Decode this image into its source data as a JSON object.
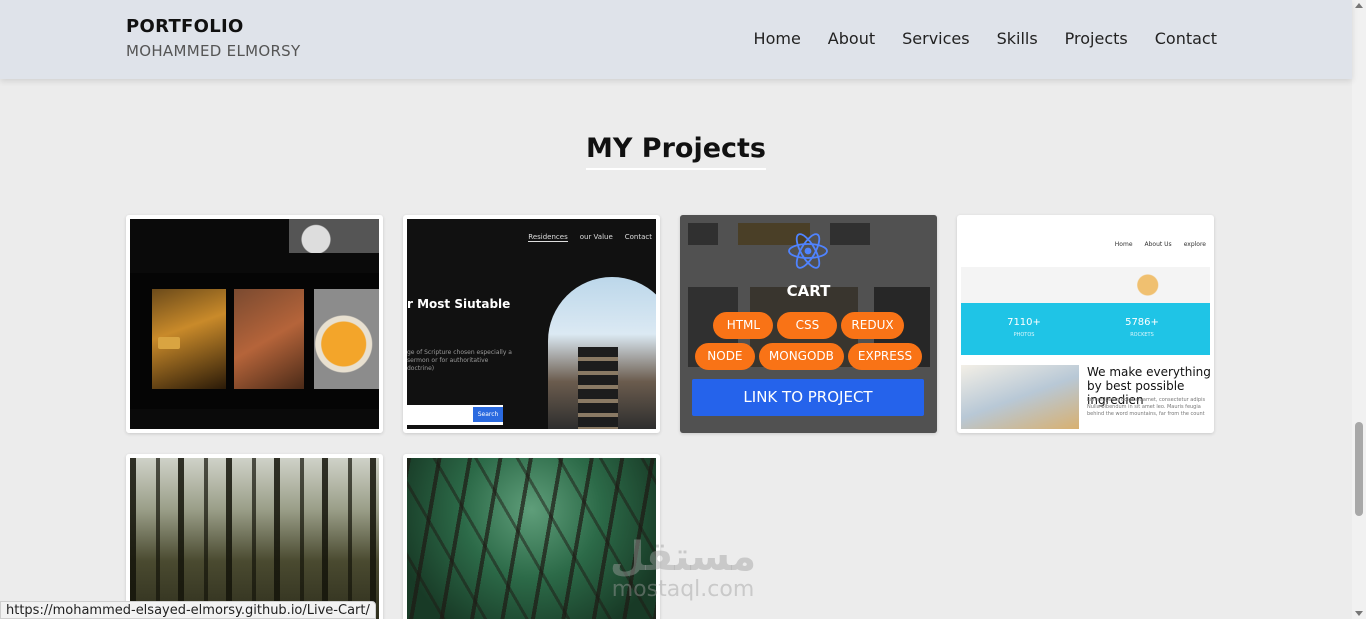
{
  "header": {
    "brand_title": "PORTFOLIO",
    "brand_subtitle": "MOHAMMED ELMORSY",
    "nav": [
      "Home",
      "About",
      "Services",
      "Skills",
      "Projects",
      "Contact"
    ]
  },
  "section": {
    "title": "MY Projects"
  },
  "cards": {
    "card2": {
      "nav": [
        "Residences",
        "our Value",
        "Contact"
      ],
      "heading": "r Most Siutable",
      "paragraph": "ge of Scripture chosen especially a sermon or for authoritative doctrine)",
      "search_label": "Search"
    },
    "card3": {
      "title": "CART",
      "tags": [
        "HTML",
        "CSS",
        "REDUX",
        "NODE",
        "MONGODB",
        "EXPRESS"
      ],
      "link_label": "LINK TO PROJECT",
      "icon": "react-icon",
      "accent": "#f97316",
      "link_color": "#2563eb"
    },
    "card4": {
      "nav": [
        "Home",
        "About Us",
        "explore"
      ],
      "stat1_value": "7110+",
      "stat1_label": "PHOTOS",
      "stat2_value": "5786+",
      "stat2_label": "ROCKETS",
      "text": "We make everything by best possible ingredien",
      "small": "Lorem ipsum dolor sit amet, consectetur adipis Nulla bibendum in sit amet leo. Mauris feugia behind the word mountains, far from the count"
    }
  },
  "watermark": {
    "arabic": "مستقل",
    "latin": "mostaql.com"
  },
  "statusbar": {
    "url": "https://mohammed-elsayed-elmorsy.github.io/Live-Cart/"
  }
}
